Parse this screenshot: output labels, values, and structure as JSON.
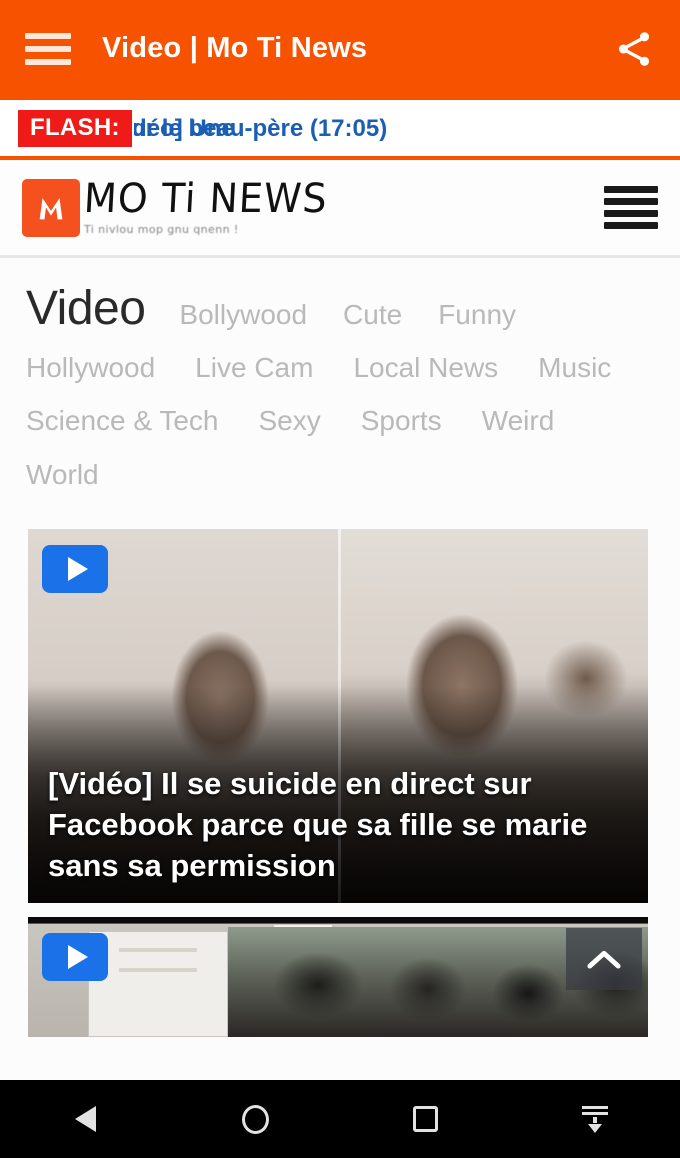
{
  "appbar": {
    "menu_icon": "hamburger-icon",
    "title": "Video | Mo Ti News",
    "share_icon": "share-icon",
    "background": "#f75200"
  },
  "flash": {
    "badge": "FLASH:",
    "badge_color": "#ee1b18",
    "text_color": "#1a5fb4",
    "ticker_text": "pour le beau-père (17:05)",
    "separator": "•",
    "ticker_text_next": "[Vidéo] Une"
  },
  "site_header": {
    "logo_mark": "m-logo-icon",
    "logo_color": "#f4511e",
    "logo_word": "MO Ti NEWS",
    "tagline": "Ti nivlou mop gnu qnenn !",
    "menu_icon": "hamburger-icon"
  },
  "main": {
    "page_title": "Video",
    "categories": [
      {
        "label": "Bollywood"
      },
      {
        "label": "Cute"
      },
      {
        "label": "Funny"
      },
      {
        "label": "Hollywood"
      },
      {
        "label": "Live Cam"
      },
      {
        "label": "Local News"
      },
      {
        "label": "Music"
      },
      {
        "label": "Science & Tech"
      },
      {
        "label": "Sexy"
      },
      {
        "label": "Sports"
      },
      {
        "label": "Weird"
      },
      {
        "label": "World"
      }
    ],
    "videos": [
      {
        "title": "[Vidéo] Il se suicide en direct sur Facebook parce que sa fille se marie sans sa permission",
        "play_icon": "play-icon"
      },
      {
        "title": "",
        "play_icon": "play-icon"
      }
    ]
  },
  "scroll_top": {
    "icon": "chevron-up-icon"
  },
  "navbar": {
    "back_icon": "back-triangle-icon",
    "home_icon": "home-circle-icon",
    "recents_icon": "recents-square-icon",
    "keyboard_hide_icon": "keyboard-hide-icon"
  }
}
